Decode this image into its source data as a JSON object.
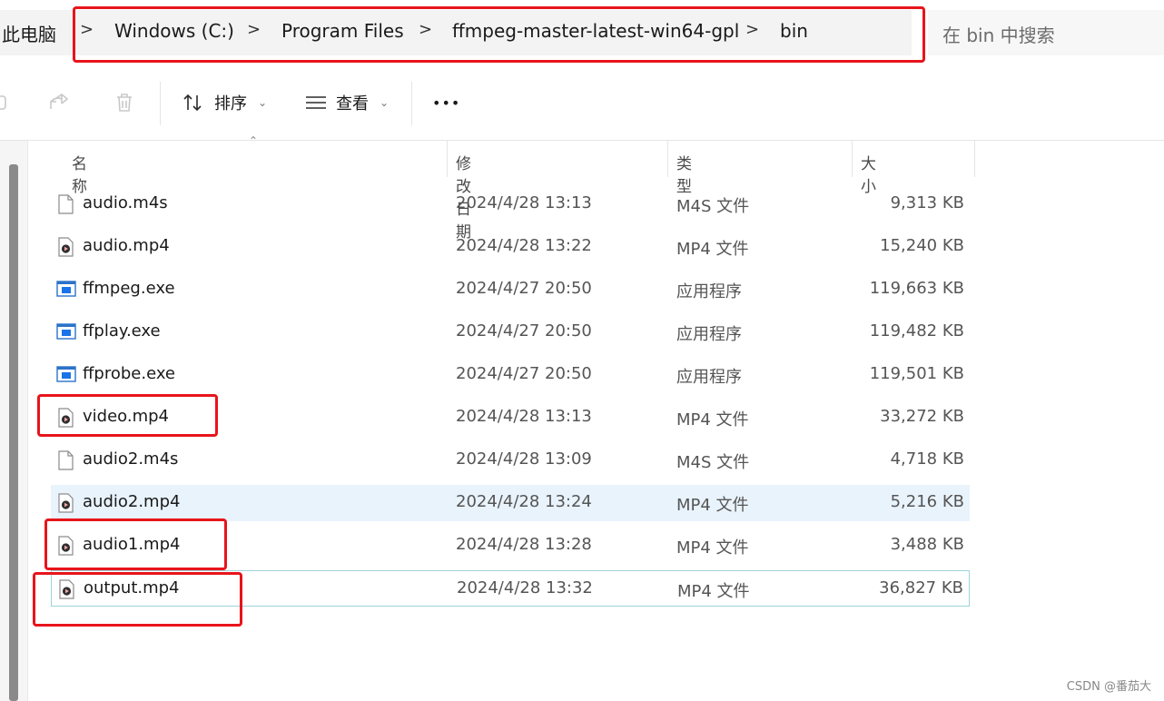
{
  "address": {
    "root": "此电脑",
    "crumbs": [
      "Windows (C:)",
      "Program Files",
      "ffmpeg-master-latest-win64-gpl",
      "bin"
    ],
    "separator": ">"
  },
  "search": {
    "placeholder": "在 bin 中搜索"
  },
  "toolbar": {
    "sort_label": "排序",
    "view_label": "查看",
    "more_label": "•••"
  },
  "columns": {
    "name": "名称",
    "date": "修改日期",
    "type": "类型",
    "size": "大小"
  },
  "files": [
    {
      "name": "audio.m4s",
      "date": "2024/4/28 13:13",
      "type": "M4S 文件",
      "size": "9,313 KB",
      "icon": "file-icon"
    },
    {
      "name": "audio.mp4",
      "date": "2024/4/28 13:22",
      "type": "MP4 文件",
      "size": "15,240 KB",
      "icon": "video-file-icon"
    },
    {
      "name": "ffmpeg.exe",
      "date": "2024/4/27 20:50",
      "type": "应用程序",
      "size": "119,663 KB",
      "icon": "exe-icon"
    },
    {
      "name": "ffplay.exe",
      "date": "2024/4/27 20:50",
      "type": "应用程序",
      "size": "119,482 KB",
      "icon": "exe-icon"
    },
    {
      "name": "ffprobe.exe",
      "date": "2024/4/27 20:50",
      "type": "应用程序",
      "size": "119,501 KB",
      "icon": "exe-icon"
    },
    {
      "name": "video.mp4",
      "date": "2024/4/28 13:13",
      "type": "MP4 文件",
      "size": "33,272 KB",
      "icon": "video-file-icon"
    },
    {
      "name": "audio2.m4s",
      "date": "2024/4/28 13:09",
      "type": "M4S 文件",
      "size": "4,718 KB",
      "icon": "file-icon"
    },
    {
      "name": "audio2.mp4",
      "date": "2024/4/28 13:24",
      "type": "MP4 文件",
      "size": "5,216 KB",
      "icon": "video-file-icon"
    },
    {
      "name": "audio1.mp4",
      "date": "2024/4/28 13:28",
      "type": "MP4 文件",
      "size": "3,488 KB",
      "icon": "video-file-icon"
    },
    {
      "name": "output.mp4",
      "date": "2024/4/28 13:32",
      "type": "MP4 文件",
      "size": "36,827 KB",
      "icon": "video-file-icon"
    }
  ],
  "watermark": "CSDN @番茄大",
  "colors": {
    "highlight_box": "#e8141b",
    "hover_row": "#e9f3fc",
    "selected_border": "#9cd3da"
  }
}
